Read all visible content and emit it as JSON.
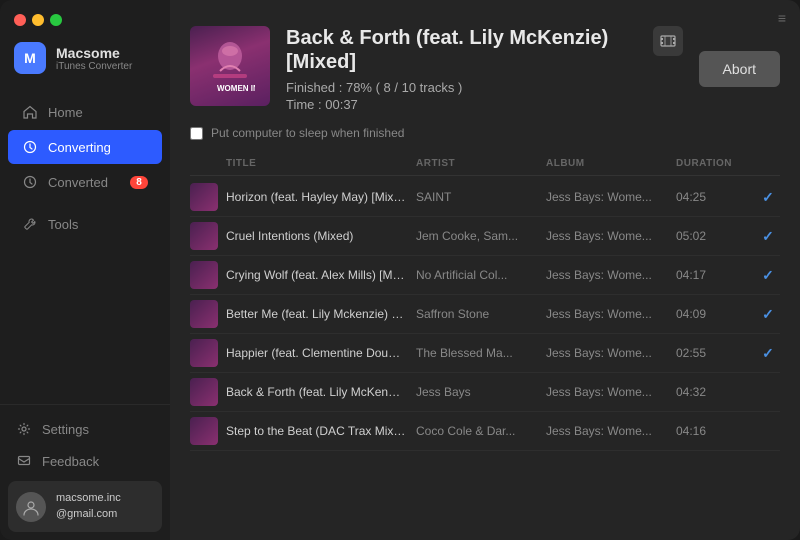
{
  "app": {
    "name": "Macsome",
    "subtitle": "iTunes Converter",
    "menu_icon": "≡"
  },
  "traffic_lights": {
    "colors": [
      "#ff5f57",
      "#ffbd2e",
      "#28c840"
    ]
  },
  "sidebar": {
    "nav_items": [
      {
        "id": "home",
        "label": "Home",
        "icon": "🏠",
        "active": false,
        "badge": null
      },
      {
        "id": "converting",
        "label": "Converting",
        "icon": "⚙",
        "active": true,
        "badge": null
      },
      {
        "id": "converted",
        "label": "Converted",
        "icon": "🕐",
        "active": false,
        "badge": "8"
      }
    ],
    "tools_label": "Tools",
    "tools_icon": "🔧",
    "settings_label": "Settings",
    "settings_icon": "⚙",
    "feedback_label": "Feedback",
    "feedback_icon": "✉",
    "user": {
      "email_line1": "macsome.inc",
      "email_line2": "@gmail.com"
    }
  },
  "conversion": {
    "title": "Back & Forth (feat. Lily McKenzie) [Mixed]",
    "progress_text": "Finished : 78% ( 8 / 10 tracks )",
    "time_text": "Time :  00:37",
    "sleep_label": "Put computer to sleep when finished",
    "abort_label": "Abort",
    "film_icon": "🎞"
  },
  "track_headers": [
    {
      "id": "thumb",
      "label": ""
    },
    {
      "id": "title",
      "label": "TITLE"
    },
    {
      "id": "artist",
      "label": "ARTIST"
    },
    {
      "id": "album",
      "label": "ALBUM"
    },
    {
      "id": "duration",
      "label": "DURATION"
    },
    {
      "id": "status",
      "label": ""
    }
  ],
  "tracks": [
    {
      "title": "Horizon (feat. Hayley May) [Mixed]",
      "artist": "SAINT",
      "album": "Jess Bays: Wome...",
      "duration": "04:25",
      "done": true
    },
    {
      "title": "Cruel Intentions (Mixed)",
      "artist": "Jem Cooke, Sam...",
      "album": "Jess Bays: Wome...",
      "duration": "05:02",
      "done": true
    },
    {
      "title": "Crying Wolf (feat. Alex Mills) [Mixed]",
      "artist": "No Artificial Col...",
      "album": "Jess Bays: Wome...",
      "duration": "04:17",
      "done": true
    },
    {
      "title": "Better Me (feat. Lily Mckenzie) [Mixed]",
      "artist": "Saffron Stone",
      "album": "Jess Bays: Wome...",
      "duration": "04:09",
      "done": true
    },
    {
      "title": "Happier (feat. Clementine Douglas) [..",
      "artist": "The Blessed Ma...",
      "album": "Jess Bays: Wome...",
      "duration": "02:55",
      "done": true
    },
    {
      "title": "Back & Forth (feat. Lily McKenzie) [Mi...",
      "artist": "Jess Bays",
      "album": "Jess Bays: Wome...",
      "duration": "04:32",
      "done": false
    },
    {
      "title": "Step to the Beat (DAC Trax Mix) [Mixed]",
      "artist": "Coco Cole & Dar...",
      "album": "Jess Bays: Wome...",
      "duration": "04:16",
      "done": false
    }
  ]
}
